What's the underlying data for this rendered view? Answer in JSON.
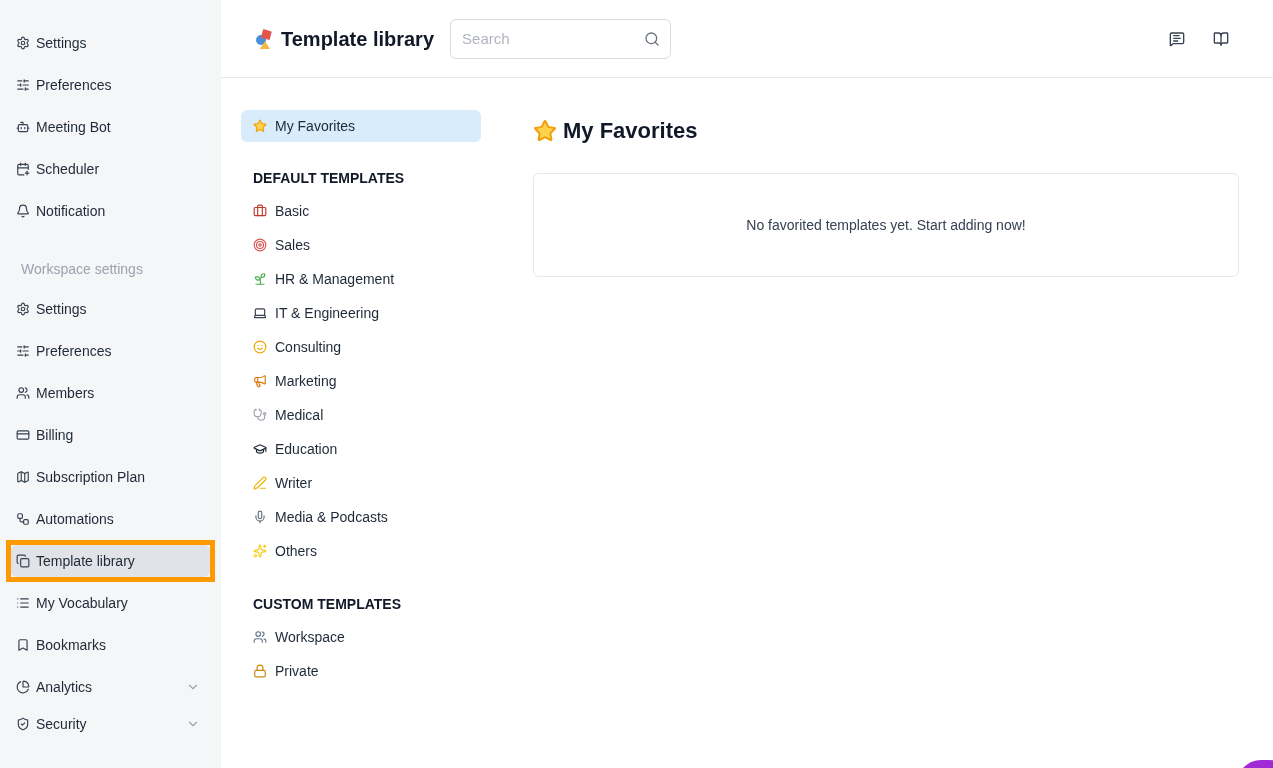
{
  "sidebar": {
    "personal_items": [
      {
        "label": "Settings",
        "selected": false
      },
      {
        "label": "Preferences",
        "selected": false
      },
      {
        "label": "Meeting Bot",
        "selected": false
      },
      {
        "label": "Scheduler",
        "selected": false
      },
      {
        "label": "Notification",
        "selected": false
      }
    ],
    "workspace_heading": "Workspace settings",
    "workspace_items": [
      {
        "label": "Settings",
        "selected": false
      },
      {
        "label": "Preferences",
        "selected": false
      },
      {
        "label": "Members",
        "selected": false
      },
      {
        "label": "Billing",
        "selected": false
      },
      {
        "label": "Subscription Plan",
        "selected": false
      },
      {
        "label": "Automations",
        "selected": false
      },
      {
        "label": "Template library",
        "selected": true
      },
      {
        "label": "My Vocabulary",
        "selected": false
      },
      {
        "label": "Bookmarks",
        "selected": false
      },
      {
        "label": "Analytics",
        "selected": false,
        "expanded": false
      },
      {
        "label": "Security",
        "selected": false,
        "expanded": false
      }
    ]
  },
  "header": {
    "title": "Template library",
    "search": {
      "placeholder": "Search"
    }
  },
  "template_nav": {
    "favorites": {
      "label": "My Favorites",
      "selected": true
    },
    "sections": [
      {
        "heading": "DEFAULT TEMPLATES",
        "items": [
          {
            "label": "Basic",
            "selected": false
          },
          {
            "label": "Sales",
            "selected": false
          },
          {
            "label": "HR & Management",
            "selected": false
          },
          {
            "label": "IT & Engineering",
            "selected": false
          },
          {
            "label": "Consulting",
            "selected": false
          },
          {
            "label": "Marketing",
            "selected": false
          },
          {
            "label": "Medical",
            "selected": false
          },
          {
            "label": "Education",
            "selected": false
          },
          {
            "label": "Writer",
            "selected": false
          },
          {
            "label": "Media & Podcasts",
            "selected": false
          },
          {
            "label": "Others",
            "selected": false
          }
        ]
      },
      {
        "heading": "CUSTOM TEMPLATES",
        "items": [
          {
            "label": "Workspace",
            "selected": false
          },
          {
            "label": "Private",
            "selected": false
          }
        ]
      }
    ]
  },
  "content": {
    "title": "My Favorites",
    "empty_message": "No favorited templates yet. Start adding now!"
  }
}
